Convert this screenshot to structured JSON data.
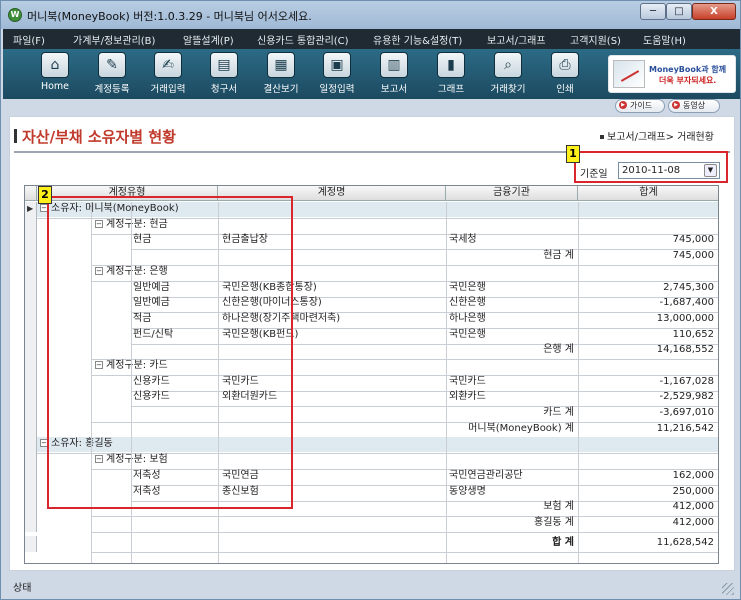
{
  "window": {
    "title": "머니북(MoneyBook) 버전:1.0.3.29 - 머니북님 어서오세요.",
    "min_label": "─",
    "max_label": "□",
    "close_label": "X"
  },
  "menu": [
    {
      "label": "파일(F)"
    },
    {
      "label": "가계부/정보관리(B)"
    },
    {
      "label": "알뜰설계(P)"
    },
    {
      "label": "신용카드 통합관리(C)"
    },
    {
      "label": "유용한 기능&설정(T)"
    },
    {
      "label": "보고서/그래프"
    },
    {
      "label": "고객지원(S)"
    },
    {
      "label": "도움말(H)"
    }
  ],
  "toolbar": [
    {
      "label": "Home",
      "icon": "home-icon",
      "glyph": "⌂"
    },
    {
      "label": "계정등록",
      "icon": "account-register-icon",
      "glyph": "✎"
    },
    {
      "label": "거래입력",
      "icon": "transaction-input-icon",
      "glyph": "✍"
    },
    {
      "label": "청구서",
      "icon": "bill-icon",
      "glyph": "▤"
    },
    {
      "label": "결산보기",
      "icon": "settlement-icon",
      "glyph": "▦"
    },
    {
      "label": "일정입력",
      "icon": "calendar-icon",
      "glyph": "▣"
    },
    {
      "label": "보고서",
      "icon": "report-icon",
      "glyph": "▥"
    },
    {
      "label": "그래프",
      "icon": "graph-icon",
      "glyph": "▮"
    },
    {
      "label": "거래찾기",
      "icon": "search-icon",
      "glyph": "⌕"
    },
    {
      "label": "인쇄",
      "icon": "print-icon",
      "glyph": "⎙"
    }
  ],
  "promo": {
    "line1": "MoneyBook과 함께",
    "line2": "더욱 부자되세요."
  },
  "links": {
    "guide": "가이드",
    "video": "동영상"
  },
  "page": {
    "title": "자산/부채 소유자별 현황",
    "breadcrumb": "보고서/그래프> 거래현황",
    "date_label": "기준일",
    "date_value": "2010-11-08"
  },
  "grid": {
    "headers": [
      "계정유형",
      "계정명",
      "금융기관",
      "합계"
    ],
    "rows": [
      {
        "kind": "owner",
        "text": "소유자: 머니북(MoneyBook)"
      },
      {
        "kind": "group",
        "text": "계정구분: 현금"
      },
      {
        "kind": "item",
        "type": "현금",
        "name": "현금출납장",
        "bank": "국세청",
        "amount": "745,000"
      },
      {
        "kind": "subtotal",
        "label": "현금 계",
        "amount": "745,000"
      },
      {
        "kind": "group",
        "text": "계정구분: 은행"
      },
      {
        "kind": "item",
        "type": "일반예금",
        "name": "국민은행(KB종합통장)",
        "bank": "국민은행",
        "amount": "2,745,300"
      },
      {
        "kind": "item",
        "type": "일반예금",
        "name": "신한은행(마이너스통장)",
        "bank": "신한은행",
        "amount": "-1,687,400"
      },
      {
        "kind": "item",
        "type": "적금",
        "name": "하나은행(장기주택마련저축)",
        "bank": "하나은행",
        "amount": "13,000,000"
      },
      {
        "kind": "item",
        "type": "펀드/신탁",
        "name": "국민은행(KB펀드)",
        "bank": "국민은행",
        "amount": "110,652"
      },
      {
        "kind": "subtotal",
        "label": "은행 계",
        "amount": "14,168,552"
      },
      {
        "kind": "group",
        "text": "계정구분: 카드"
      },
      {
        "kind": "item",
        "type": "신용카드",
        "name": "국민카드",
        "bank": "국민카드",
        "amount": "-1,167,028"
      },
      {
        "kind": "item",
        "type": "신용카드",
        "name": "외환더원카드",
        "bank": "외환카드",
        "amount": "-2,529,982"
      },
      {
        "kind": "subtotal",
        "label": "카드 계",
        "amount": "-3,697,010"
      },
      {
        "kind": "ownertotal",
        "label": "머니북(MoneyBook) 계",
        "amount": "11,216,542"
      },
      {
        "kind": "owner",
        "text": "소유자: 홍길동"
      },
      {
        "kind": "group",
        "text": "계정구분: 보험"
      },
      {
        "kind": "item",
        "type": "저축성",
        "name": "국민연금",
        "bank": "국민연금관리공단",
        "amount": "162,000"
      },
      {
        "kind": "item",
        "type": "저축성",
        "name": "종신보험",
        "bank": "동양생명",
        "amount": "250,000"
      },
      {
        "kind": "subtotal",
        "label": "보험 계",
        "amount": "412,000"
      },
      {
        "kind": "ownertotal",
        "label": "홍길동 계",
        "amount": "412,000"
      },
      {
        "kind": "grandtotal",
        "label": "합 계",
        "amount": "11,628,542"
      }
    ]
  },
  "annotations": [
    {
      "number": "1"
    },
    {
      "number": "2"
    }
  ],
  "status": {
    "text": "상태"
  }
}
